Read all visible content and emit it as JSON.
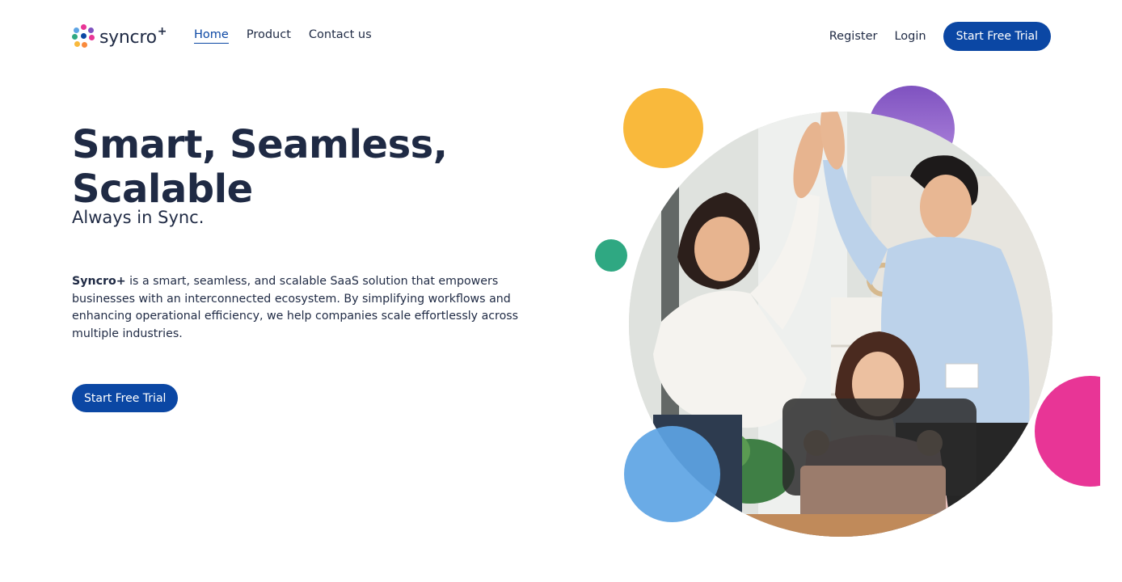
{
  "brand": {
    "name": "syncro",
    "suffix": "+"
  },
  "nav": {
    "items": [
      {
        "label": "Home",
        "active": true
      },
      {
        "label": "Product",
        "active": false
      },
      {
        "label": "Contact us",
        "active": false
      }
    ]
  },
  "header": {
    "register_label": "Register",
    "login_label": "Login",
    "cta_label": "Start Free Trial"
  },
  "hero": {
    "headline": "Smart, Seamless, Scalable",
    "subheadline": "Always in Sync.",
    "description_brand": "Syncro+",
    "description_text": " is a smart, seamless, and scalable SaaS solution that empowers businesses with an interconnected ecosystem. By simplifying workflows and enhancing operational efficiency, we help companies scale effortlessly across multiple industries.",
    "cta_label": "Start Free Trial",
    "image_icon": "team-celebration-photo"
  },
  "colors": {
    "primary": "#0b47a4",
    "text": "#1f2a44",
    "accent_yellow": "#f9b93c",
    "accent_purple": "#7f52c0",
    "accent_green": "#2fa882",
    "accent_pink": "#e83596",
    "accent_blue": "#5da4e4"
  }
}
